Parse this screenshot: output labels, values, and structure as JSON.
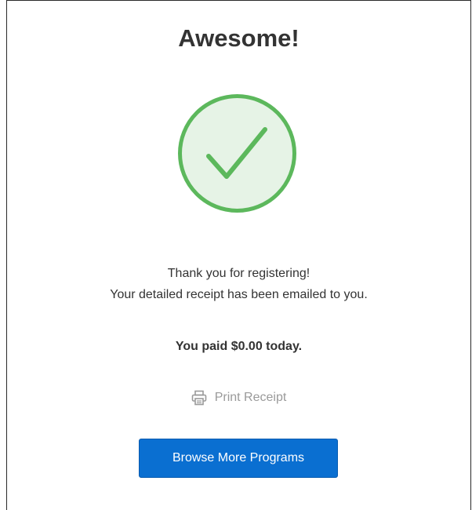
{
  "header": {
    "title": "Awesome!"
  },
  "status": {
    "icon": "check-circle-icon",
    "icon_color": "#5cb85c",
    "icon_fill": "#e6f3e6"
  },
  "message": {
    "line1": "Thank you for registering!",
    "line2": "Your detailed receipt has been emailed to you."
  },
  "payment": {
    "summary": "You paid $0.00 today."
  },
  "actions": {
    "print_icon": "printer-icon",
    "print_label": "Print Receipt",
    "browse_label": "Browse More Programs",
    "browse_color": "#0a6fd1"
  }
}
